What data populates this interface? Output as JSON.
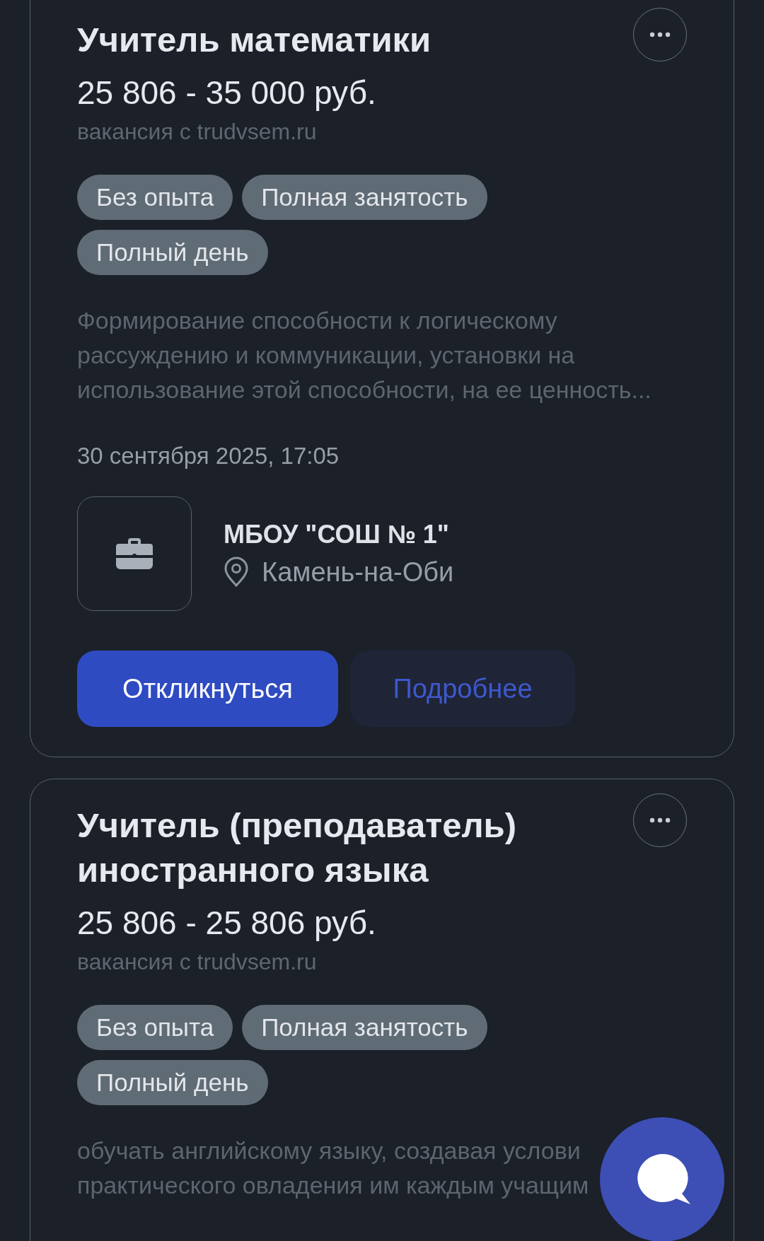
{
  "vacancies": [
    {
      "title": "Учитель математики",
      "salary": "25 806 - 35 000 руб.",
      "source": "вакансия с trudvsem.ru",
      "tags": [
        "Без опыта",
        "Полная занятость",
        "Полный день"
      ],
      "description": "Формирование способности к логическому\nрассуждению и коммуникации, установки на\nиспользование этой способности, на ее ценность...",
      "date": "30 сентября 2025, 17:05",
      "employer": "МБОУ \"СОШ № 1\"",
      "city": "Камень-на-Оби",
      "buttons": [
        {
          "label": "Откликнуться",
          "kind": "primary"
        },
        {
          "label": "Подробнее",
          "kind": "secondary"
        }
      ]
    },
    {
      "title": "Учитель (преподаватель)\nиностранного языка",
      "salary": "25 806 - 25 806 руб.",
      "source": "вакансия с trudvsem.ru",
      "tags": [
        "Без опыта",
        "Полная занятость",
        "Полный день"
      ],
      "description": "обучать английскому языку, создавая услови\nпрактического овладения им каждым учащим"
    }
  ]
}
